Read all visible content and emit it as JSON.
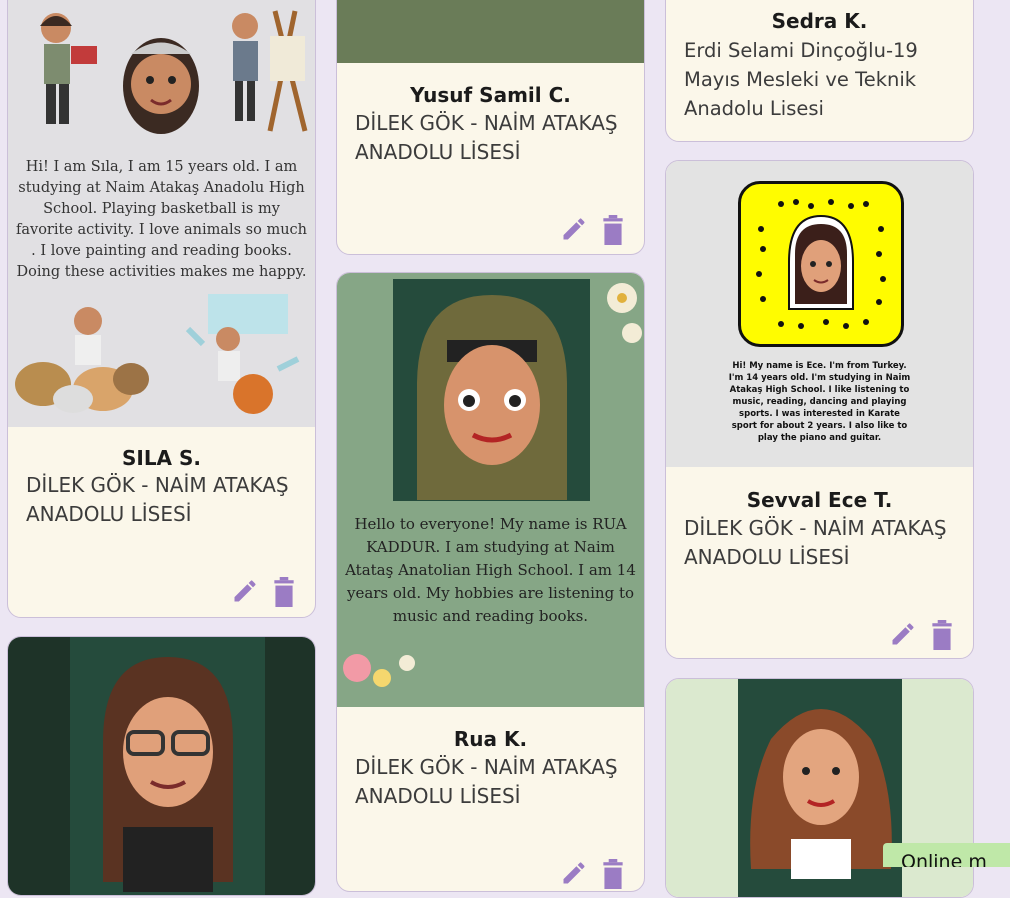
{
  "cards": {
    "sila": {
      "image_text": "Hi! I am Sıla, I am 15 years old. I am studying at Naim Atakaş Anadolu High School. Playing basketball is my favorite activity. I love animals so much . I love painting and reading books. Doing these activities makes me happy.",
      "name": "SILA S.",
      "school": "DİLEK GÖK - NAİM ATAKAŞ ANADOLU LİSESİ"
    },
    "yusuf": {
      "name": "Yusuf Samil C.",
      "school": "DİLEK GÖK - NAİM ATAKAŞ ANADOLU LİSESİ"
    },
    "rua": {
      "image_text": "Hello to everyone! My name is RUA KADDUR. I am studying at Naim Atataş Anatolian High School. I am 14 years old. My hobbies are listening to music and reading books.",
      "name": "Rua K.",
      "school": "DİLEK GÖK - NAİM ATAKAŞ ANADOLU LİSESİ"
    },
    "sedra": {
      "name": "Sedra K.",
      "school": "Erdi Selami Dinçoğlu-19 Mayıs Mesleki ve Teknik Anadolu Lisesi"
    },
    "sevval": {
      "image_text": "Hi! My name is Ece. I'm from Turkey. I'm 14 years old. I'm studying in Naim Atakaş High School. I like listening to music, reading, dancing and playing sports. I was interested in Karate sport for about 2 years. I also like to play the piano and guitar.",
      "name": "Sevval Ece T.",
      "school": "DİLEK GÖK - NAİM ATAKAŞ ANADOLU LİSESİ"
    }
  },
  "online_badge": "Online m",
  "icons": {
    "edit": "pencil-icon",
    "delete": "trash-icon"
  },
  "colors": {
    "accent": "#9b7cc4",
    "card": "#fbf7ea",
    "background": "#ece6f3",
    "online": "#bfe8a8"
  }
}
